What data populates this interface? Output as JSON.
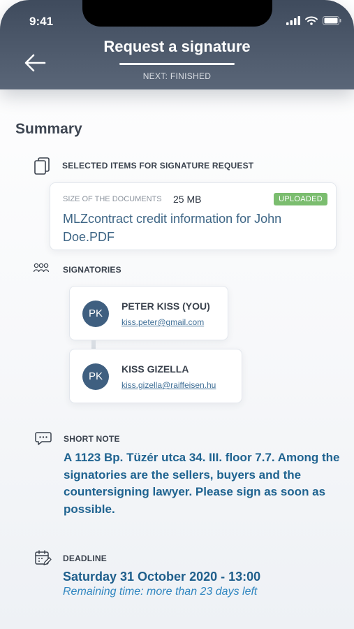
{
  "status_bar": {
    "time": "9:41"
  },
  "header": {
    "title": "Request a signature",
    "next_step": "NEXT: FINISHED"
  },
  "summary": {
    "heading": "Summary",
    "selected_items": {
      "label": "SELECTED ITEMS FOR SIGNATURE REQUEST",
      "document": {
        "size_label": "SIZE OF THE DOCUMENTS",
        "size_value": "25 MB",
        "status": "UPLOADED",
        "name": "MLZcontract credit information for John Doe.PDF"
      }
    },
    "signatories": {
      "label": "SIGNATORIES",
      "items": [
        {
          "initials": "PK",
          "name": "PETER KISS (YOU)",
          "email": "kiss.peter@gmail.com"
        },
        {
          "initials": "PK",
          "name": "KISS GIZELLA",
          "email": "kiss.gizella@raiffeisen.hu"
        }
      ]
    },
    "short_note": {
      "label": "SHORT NOTE",
      "text": "A 1123 Bp. Tüzér utca 34. III. floor 7.7. Among the signatories are the sellers, buyers and the countersigning lawyer. Please sign as soon as possible."
    },
    "deadline": {
      "label": "DEADLINE",
      "value": "Saturday 31 October 2020 - 13:00",
      "remaining": "Remaining time: more than 23 days left"
    }
  },
  "colors": {
    "header": "#4a5669",
    "accent": "#1f6390",
    "badge": "#7bbd6f",
    "avatar": "#3f5f80"
  }
}
